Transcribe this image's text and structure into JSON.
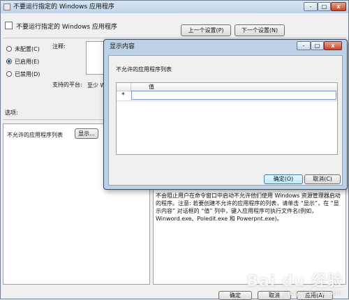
{
  "main_window": {
    "title": "不要运行指定的 Windows 应用程序",
    "policy_name": "不要运行指定的 Windows 应用程序",
    "prev_button": "上一个设置(P)",
    "next_button": "下一个设置(N)",
    "radio_not_configured": "未配置(C)",
    "radio_enabled": "已启用(E)",
    "radio_disabled": "已禁用(D)",
    "selected_state": "enabled",
    "comment_label": "注释:",
    "platform_label": "支持的平台:",
    "platform_value": "至少 W",
    "options_label": "选项:",
    "list_label": "不允许的应用程序列表",
    "show_button": "显示...",
    "help_text": "不会阻止用户在命令窗口中启动不允许他们使用 Windows 资源管理器启动的程序。注意: 若要创建不允许的应用程序的列表，请单击 “显示”，在 “显示内容” 对话框的 “值” 列中，键入应用程序可执行文件名(例如，Winword.exe、Poledit.exe 和 Powerpnt.exe)。",
    "ok_button": "确定",
    "cancel_button": "取消",
    "apply_button": "应用(A)"
  },
  "dialog": {
    "title": "显示内容",
    "list_caption": "不允许的应用程序列表",
    "column_header": "值",
    "new_row_marker": "*",
    "ok_button": "确定(O)",
    "cancel_button": "取消(C)"
  },
  "window_controls": {
    "minimize": "-",
    "maximize": "□",
    "close": "x"
  },
  "watermark": {
    "brand": "Bai du 经验",
    "url": "jingyan.baidu.com"
  },
  "colors": {
    "title_bar": "#bfd3ea",
    "dialog_frame": "#bcd0e6",
    "close_button": "#c7442a",
    "radio_selected": "#2a5d9c"
  }
}
